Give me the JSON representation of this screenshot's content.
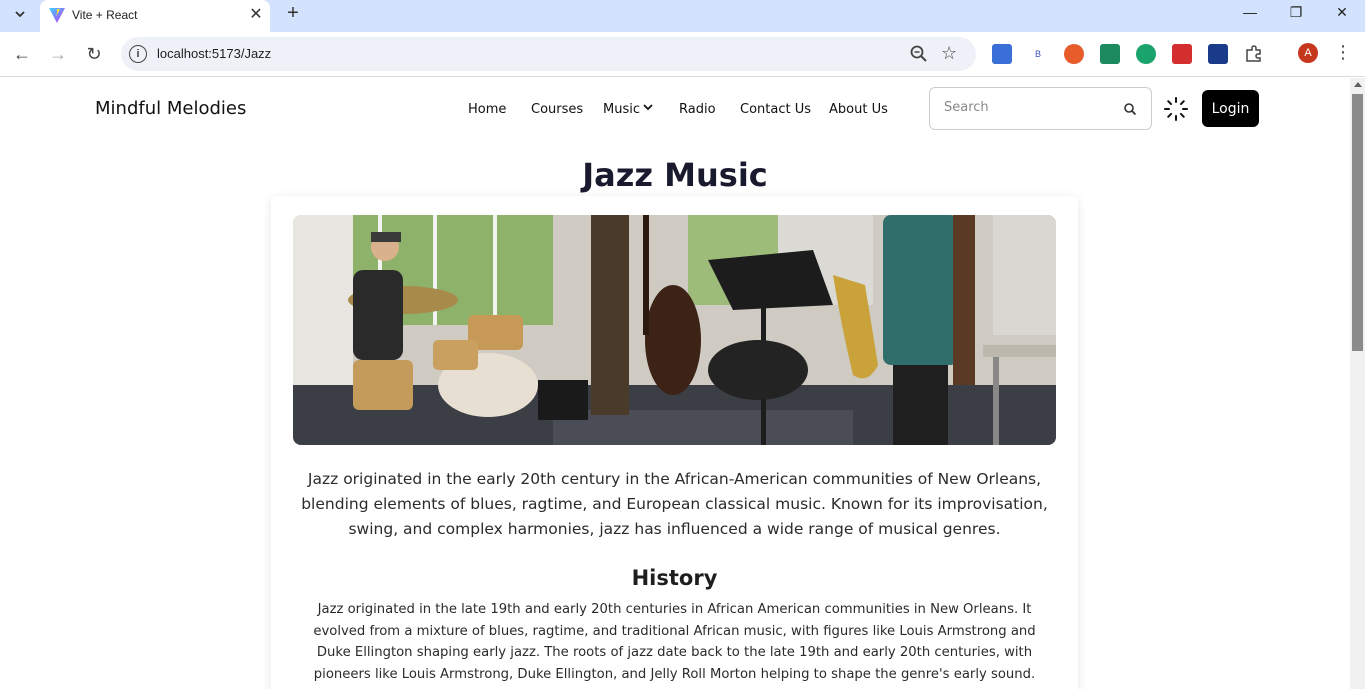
{
  "browser": {
    "tab_title": "Vite + React",
    "url": "localhost:5173/Jazz",
    "avatar_initial": "A"
  },
  "site": {
    "brand": "Mindful Melodies",
    "nav": {
      "home": "Home",
      "courses": "Courses",
      "music": "Music",
      "radio": "Radio",
      "contact": "Contact Us",
      "about": "About Us"
    },
    "search_placeholder": "Search",
    "login_label": "Login"
  },
  "page": {
    "title": "Jazz Music",
    "intro": "Jazz originated in the early 20th century in the African-American communities of New Orleans, blending elements of blues, ragtime, and European classical music. Known for its improvisation, swing, and complex harmonies, jazz has influenced a wide range of musical genres.",
    "history_heading": "History",
    "history_text": "Jazz originated in the late 19th and early 20th centuries in African American communities in New Orleans. It evolved from a mixture of blues, ragtime, and traditional African music, with figures like Louis Armstrong and Duke Ellington shaping early jazz. The roots of jazz date back to the late 19th and early 20th centuries, with pioneers like Louis Armstrong, Duke Ellington, and Jelly Roll Morton helping to shape the genre's early sound."
  },
  "colors": {
    "login_bg": "#000000",
    "tabbar_bg": "#d3e3fd",
    "avatar_bg": "#c5381e"
  }
}
